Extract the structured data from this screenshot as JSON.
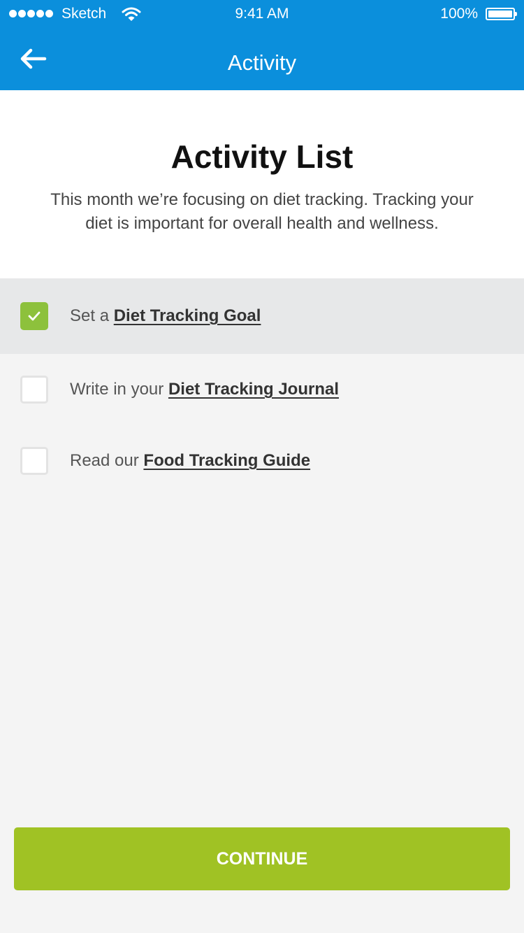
{
  "status_bar": {
    "carrier": "Sketch",
    "time": "9:41 AM",
    "battery": "100%",
    "battery_level": 1.0
  },
  "nav": {
    "title": "Activity",
    "back_icon": "arrow-left-icon"
  },
  "intro": {
    "title": "Activity List",
    "description": "This month we’re focusing on diet tracking. Tracking your diet is important for overall health and wellness."
  },
  "activities": [
    {
      "prefix": "Set a ",
      "link": "Diet Tracking Goal",
      "checked": true
    },
    {
      "prefix": "Write in your ",
      "link": "Diet Tracking Journal",
      "checked": false
    },
    {
      "prefix": "Read our ",
      "link": "Food Tracking Guide",
      "checked": false
    }
  ],
  "continue_label": "CONTINUE",
  "colors": {
    "header": "#0b8fdc",
    "accent_green": "#a0c224",
    "checkbox_green": "#8dc13c",
    "completed_row": "#e7e8e9",
    "background": "#f4f4f4"
  }
}
